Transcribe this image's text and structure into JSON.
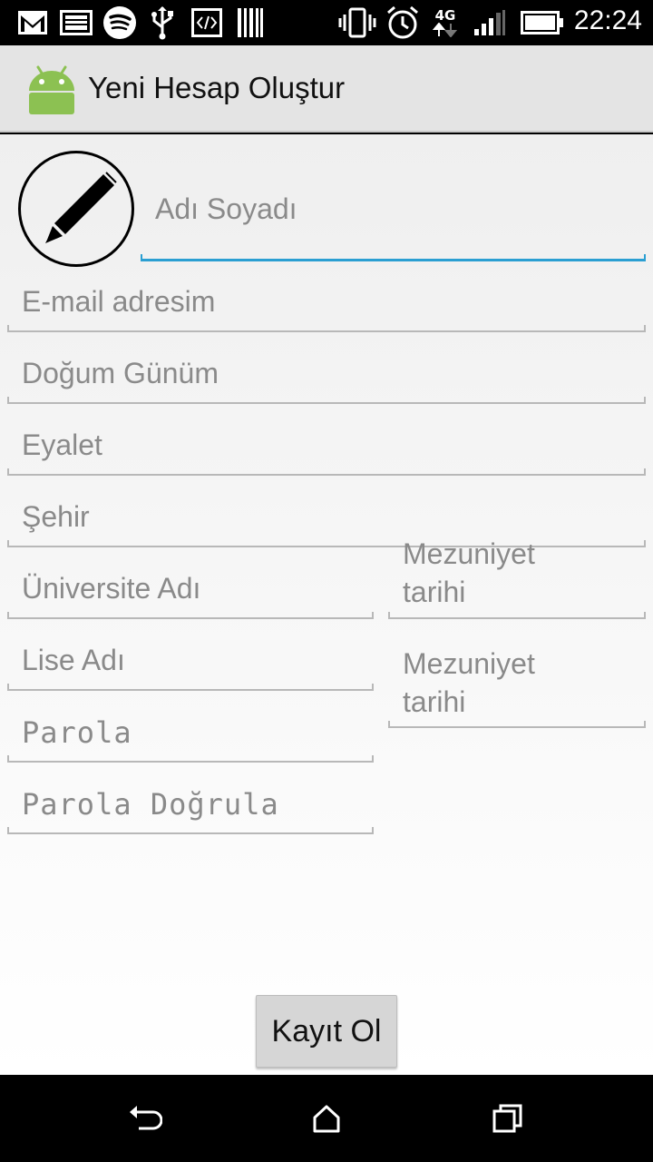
{
  "status_bar": {
    "time": "22:24",
    "network": "4G",
    "icons": [
      "gmail-icon",
      "image-icon",
      "spotify-icon",
      "usb-icon",
      "code-icon",
      "barcode-icon",
      "vibrate-icon",
      "alarm-icon",
      "network-4g-icon",
      "signal-icon",
      "battery-icon"
    ]
  },
  "action_bar": {
    "title": "Yeni Hesap Oluştur",
    "icon": "android-icon"
  },
  "form": {
    "name_placeholder": "Adı Soyadı",
    "email_placeholder": "E-mail adresim",
    "birthday_placeholder": "Doğum Günüm",
    "state_placeholder": "Eyalet",
    "city_placeholder": "Şehir",
    "university_placeholder": "Üniversite Adı",
    "university_grad_line1": "Mezuniyet",
    "university_grad_line2": "tarihi",
    "highschool_placeholder": "Lise Adı",
    "highschool_grad_line1": "Mezuniyet",
    "highschool_grad_line2": "tarihi",
    "password_placeholder": "Parola",
    "password_confirm_placeholder": "Parola Doğrula",
    "submit_label": "Kayıt Ol"
  },
  "nav_bar": {
    "buttons": [
      "back-icon",
      "home-icon",
      "recents-icon"
    ]
  },
  "colors": {
    "accent": "#2b9fd2",
    "action_bar": "#e4e4e4",
    "android_green": "#8cc152"
  }
}
